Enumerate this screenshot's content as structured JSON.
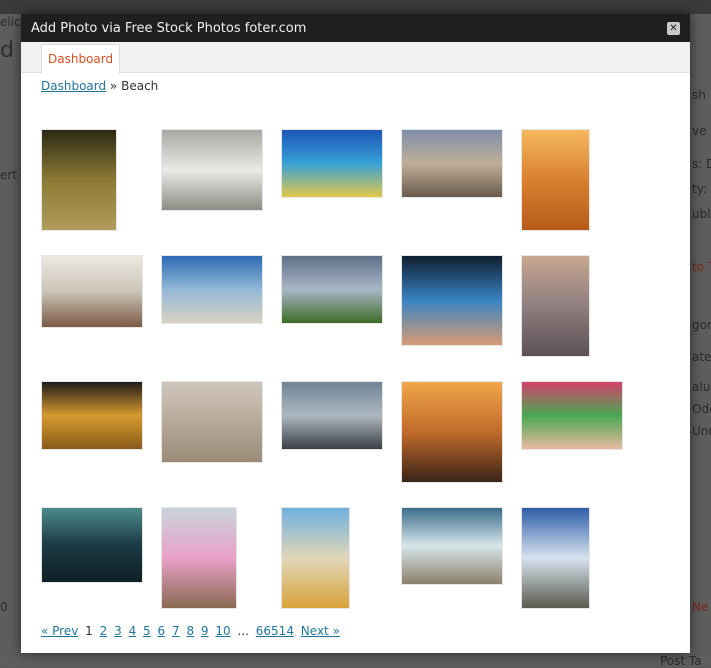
{
  "background": {
    "fragments": [
      "elicenter",
      "d",
      "sh",
      "ve I",
      "s: De",
      "ty: P",
      "ublis",
      "to T",
      "gor",
      "ateg",
      "aluz",
      "Odc",
      "Unc",
      "ert",
      "0",
      "Ne",
      "Post Ta"
    ]
  },
  "modal": {
    "title": "Add Photo via Free Stock Photos foter.com",
    "close_label": "✕",
    "tab_label": "Dashboard",
    "breadcrumb": {
      "link": "Dashboard",
      "separator": " » ",
      "current": "Beach"
    }
  },
  "photos": [
    {
      "label": "Pier pilings at dusk",
      "colors": [
        "#2c2a16",
        "#8c7a34",
        "#b19c5c"
      ]
    },
    {
      "label": "White ibis on shore",
      "colors": [
        "#a7a9a2",
        "#e9e9e6",
        "#8d8d86"
      ]
    },
    {
      "label": "Tropical beach with blue sky",
      "colors": [
        "#1e56b8",
        "#37a1d7",
        "#e4c84a"
      ]
    },
    {
      "label": "Couple on beach",
      "colors": [
        "#7f8fa9",
        "#bfae96",
        "#6a5b4d"
      ]
    },
    {
      "label": "Orange sand dunes",
      "colors": [
        "#f5b860",
        "#d9802e",
        "#b65b1b"
      ]
    },
    {
      "label": "Person lying in surf",
      "colors": [
        "#ede9e2",
        "#cbc4b7",
        "#7c5a43"
      ]
    },
    {
      "label": "Blue bay with boats",
      "colors": [
        "#2d6bb3",
        "#93b8d6",
        "#d9d2c2"
      ]
    },
    {
      "label": "Lighthouse and palm",
      "colors": [
        "#5f6f86",
        "#a8b7c7",
        "#3d6b25"
      ]
    },
    {
      "label": "Ocean waves at sunset",
      "colors": [
        "#0e1d2f",
        "#3a84c4",
        "#d79b74"
      ]
    },
    {
      "label": "Figure at sunset tide",
      "colors": [
        "#c8a78f",
        "#8e7f80",
        "#5d5153"
      ]
    },
    {
      "label": "Bird silhouette on gold sand",
      "colors": [
        "#1f1b1a",
        "#d59a2e",
        "#8a5c1b"
      ]
    },
    {
      "label": "Foggy shoreline",
      "colors": [
        "#cfc6bc",
        "#b7a998",
        "#9b8a78"
      ]
    },
    {
      "label": "Rocky bay at dusk",
      "colors": [
        "#6f8595",
        "#adb8c0",
        "#3b3e45"
      ]
    },
    {
      "label": "People walking at orange sunset",
      "colors": [
        "#f0a64a",
        "#c06a2a",
        "#3a2418"
      ]
    },
    {
      "label": "Sunbathers on colorful towels",
      "colors": [
        "#d2426a",
        "#4aa854",
        "#e8b9a0"
      ]
    },
    {
      "label": "Stormy sea horizon",
      "colors": [
        "#4c8a8a",
        "#1b3a45",
        "#0f1f24"
      ]
    },
    {
      "label": "Girl in pink bikini",
      "colors": [
        "#c9d4dc",
        "#e8a0c8",
        "#8a6a52"
      ]
    },
    {
      "label": "Beer bottle in sand",
      "colors": [
        "#6fb0dd",
        "#e1d7b9",
        "#d8a33a"
      ]
    },
    {
      "label": "Woman in shore waves",
      "colors": [
        "#3c6e8c",
        "#d7e5ea",
        "#8b7f6b"
      ]
    },
    {
      "label": "Beach curve with clouds",
      "colors": [
        "#2e5da8",
        "#d6e2ee",
        "#5b5b4f"
      ]
    }
  ],
  "pagination": {
    "prev": "« Prev",
    "current": "1",
    "pages": [
      "2",
      "3",
      "4",
      "5",
      "6",
      "7",
      "8",
      "9",
      "10"
    ],
    "ellipsis": "...",
    "last": "66514",
    "next": "Next »"
  }
}
